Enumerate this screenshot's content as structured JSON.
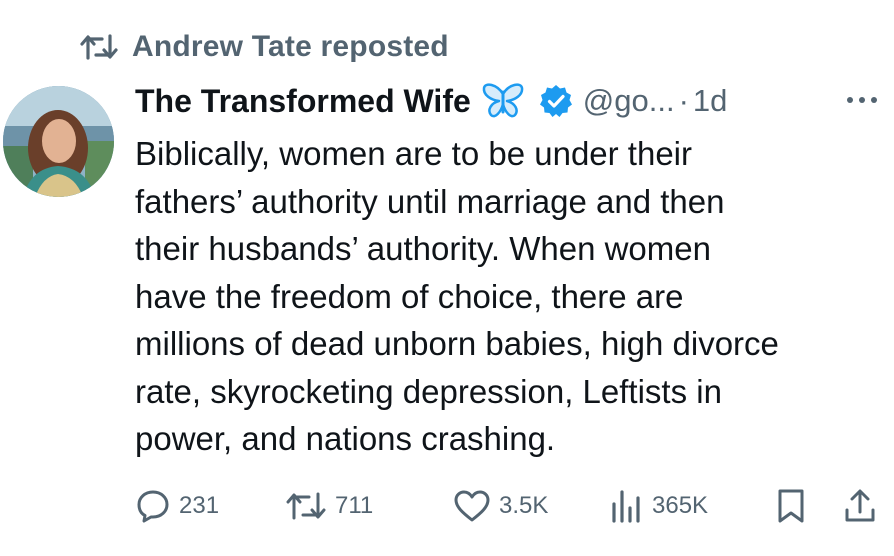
{
  "repost": {
    "label": "Andrew Tate reposted",
    "icon": "repost-icon"
  },
  "author": {
    "name": "The Transformed Wife",
    "emoji_icon": "butterfly-icon",
    "verified_icon": "verified-badge-icon",
    "handle": "@go...",
    "separator": "·",
    "time": "1d"
  },
  "tweet": {
    "text": "Biblically, women are to be under their\nfathers’ authority until marriage and then\ntheir husbands’ authority. When women\nhave the freedom of choice, there are\nmillions of dead unborn babies, high divorce\nrate, skyrocketing depression, Leftists in\npower, and nations crashing."
  },
  "actions": {
    "replies": "231",
    "reposts": "711",
    "likes": "3.5K",
    "views": "365K"
  },
  "colors": {
    "secondary_text": "#536471",
    "primary_text": "#0f1419",
    "verified": "#1d9bf0",
    "butterfly": "#1d9bf0"
  }
}
